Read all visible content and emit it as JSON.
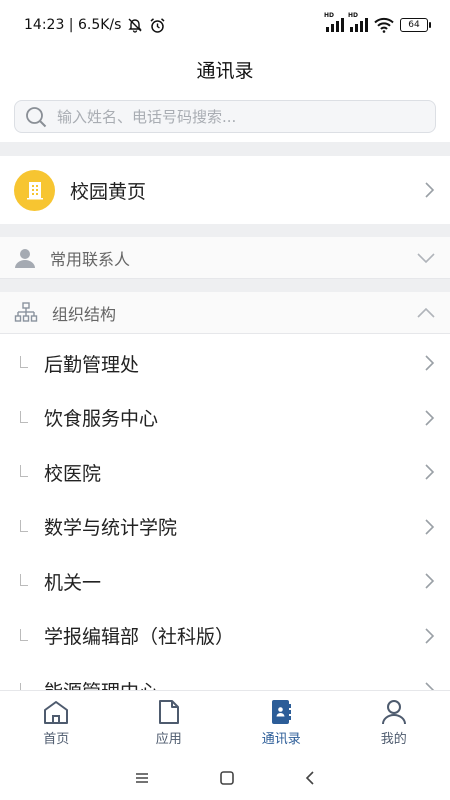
{
  "status_bar": {
    "time_speed": "14:23 | 6.5K/s",
    "battery": "64",
    "hd1": "HD",
    "hd2": "HD"
  },
  "header": {
    "title": "通讯录"
  },
  "search": {
    "placeholder": "输入姓名、电话号码搜索..."
  },
  "yellow_pages": {
    "label": "校园黄页",
    "icon": "building-icon",
    "color": "#f7c531"
  },
  "frequent_contacts": {
    "label": "常用联系人",
    "icon": "person-icon",
    "expanded": false
  },
  "org_structure": {
    "label": "组织结构",
    "icon": "org-tree-icon",
    "expanded": true,
    "items": [
      {
        "label": "后勤管理处"
      },
      {
        "label": "饮食服务中心"
      },
      {
        "label": "校医院"
      },
      {
        "label": "数学与统计学院"
      },
      {
        "label": "机关一"
      },
      {
        "label": "学报编辑部（社科版）"
      },
      {
        "label": "能源管理中心"
      }
    ]
  },
  "tabbar": {
    "tabs": [
      {
        "label": "首页",
        "icon": "home-icon",
        "active": false
      },
      {
        "label": "应用",
        "icon": "document-icon",
        "active": false
      },
      {
        "label": "通讯录",
        "icon": "contacts-book-icon",
        "active": true
      },
      {
        "label": "我的",
        "icon": "profile-icon",
        "active": false
      }
    ],
    "active_color": "#2c5d98",
    "inactive_color": "#4e5b6e"
  },
  "system_nav": {
    "icons": [
      "menu-icon",
      "home-square-icon",
      "back-icon"
    ]
  }
}
